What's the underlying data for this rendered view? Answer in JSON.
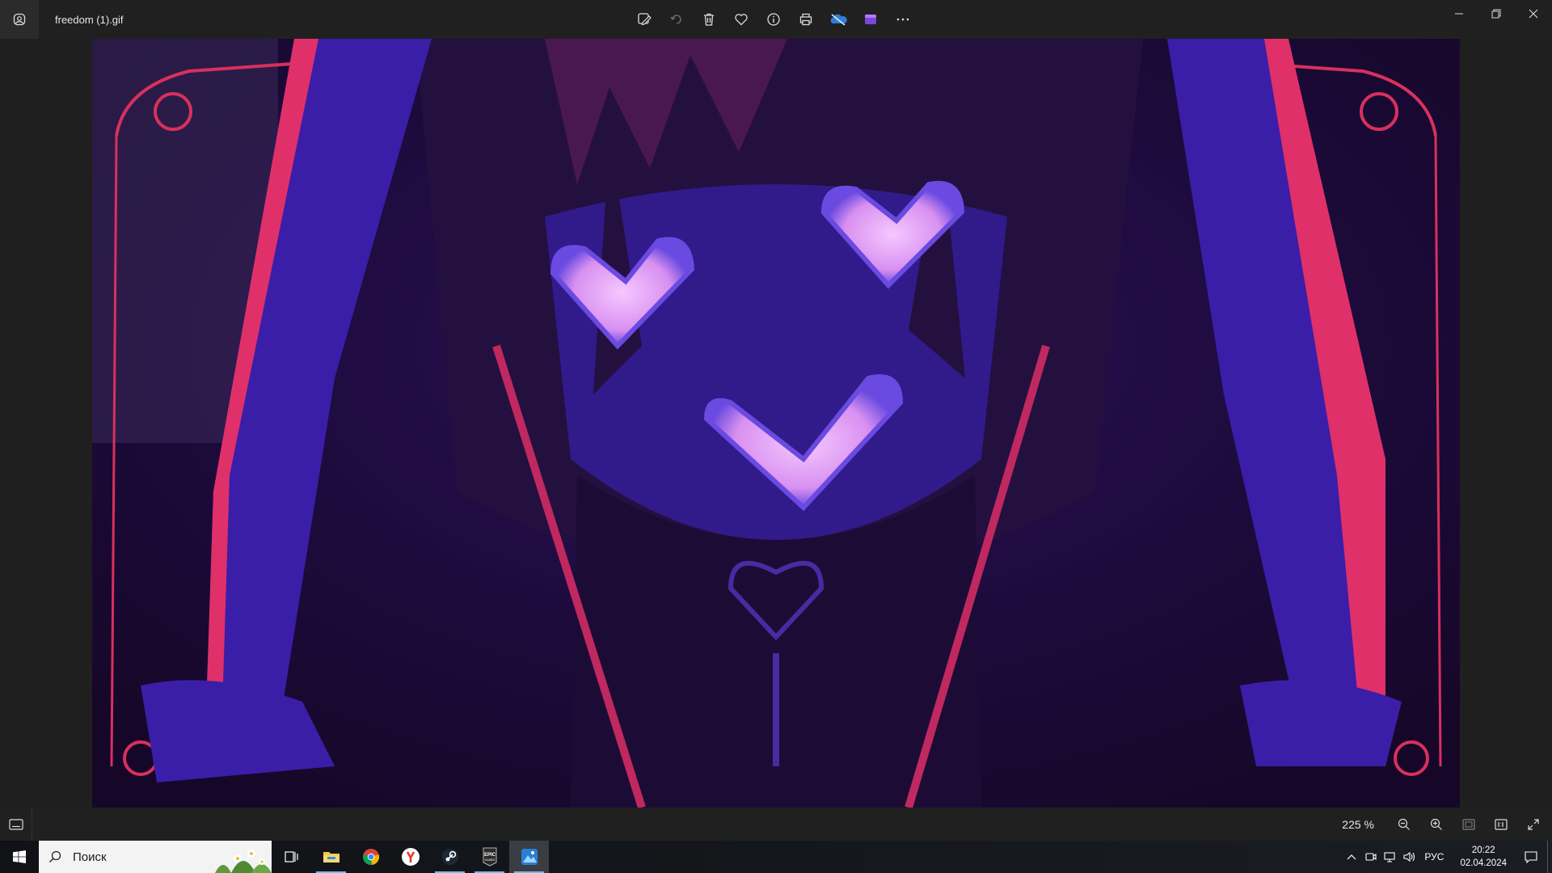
{
  "window": {
    "title": "freedom (1).gif"
  },
  "toolbar": {
    "items": [
      {
        "name": "edit-image-icon"
      },
      {
        "name": "rotate-icon"
      },
      {
        "name": "delete-icon"
      },
      {
        "name": "favorite-icon"
      },
      {
        "name": "info-icon"
      },
      {
        "name": "print-icon"
      },
      {
        "name": "onedrive-icon"
      },
      {
        "name": "clipchamp-icon"
      },
      {
        "name": "more-icon"
      }
    ]
  },
  "statusbar": {
    "zoom_value": "225 %"
  },
  "taskbar": {
    "search_placeholder": "Поиск",
    "apps": [
      {
        "name": "task-view"
      },
      {
        "name": "file-explorer"
      },
      {
        "name": "chrome"
      },
      {
        "name": "yandex-browser"
      },
      {
        "name": "steam"
      },
      {
        "name": "epic-games"
      },
      {
        "name": "photos"
      }
    ],
    "tray": {
      "language": "РУС",
      "time": "20:22",
      "date": "02.04.2024"
    }
  },
  "colors": {
    "image_bg": "#1a0b2e",
    "purple": "#3a1e9e",
    "pink_accent": "#e0306a",
    "heart_glow": "#e6a0f5"
  }
}
